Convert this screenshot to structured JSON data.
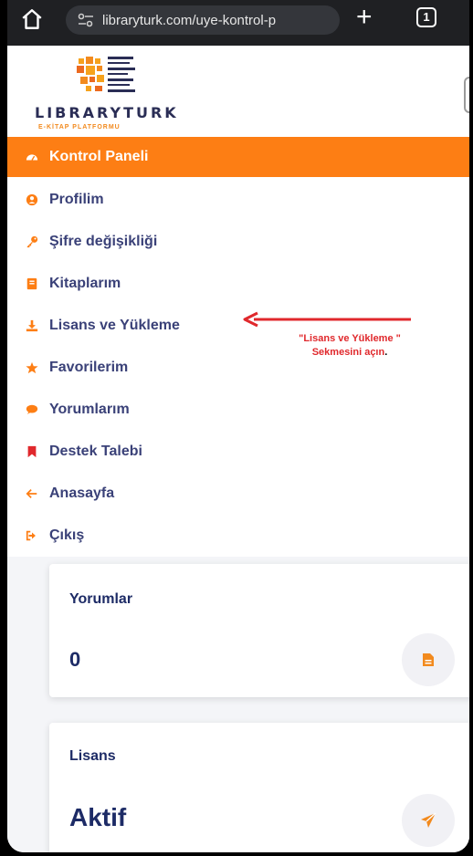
{
  "browser": {
    "url": "libraryturk.com/uye-kontrol-p",
    "tab_count": "1"
  },
  "logo": {
    "name": "LIBRARYTURK",
    "subtitle": "E-KİTAP PLATFORMU"
  },
  "menu": {
    "items": [
      {
        "label": "Kontrol Paneli",
        "icon": "dashboard-icon"
      },
      {
        "label": "Profilim",
        "icon": "user-circle-icon"
      },
      {
        "label": "Şifre değişikliği",
        "icon": "key-icon"
      },
      {
        "label": "Kitaplarım",
        "icon": "book-icon"
      },
      {
        "label": "Lisans ve Yükleme",
        "icon": "download-icon"
      },
      {
        "label": "Favorilerim",
        "icon": "star-icon"
      },
      {
        "label": "Yorumlarım",
        "icon": "comment-icon"
      },
      {
        "label": "Destek Talebi",
        "icon": "bookmark-icon"
      },
      {
        "label": "Anasayfa",
        "icon": "arrow-left-icon"
      },
      {
        "label": "Çıkış",
        "icon": "sign-out-icon"
      }
    ]
  },
  "annotation": {
    "line1": "\"Lisans ve Yükleme \"",
    "line2": "Sekmesini açın",
    "line2_dot": "."
  },
  "cards": {
    "comments": {
      "title": "Yorumlar",
      "value": "0"
    },
    "license": {
      "title": "Lisans",
      "value": "Aktif"
    }
  },
  "colors": {
    "accent": "#fd7e14",
    "menu_text": "#3a4178",
    "annotation": "#e0282c",
    "card_text": "#1d2b66"
  }
}
